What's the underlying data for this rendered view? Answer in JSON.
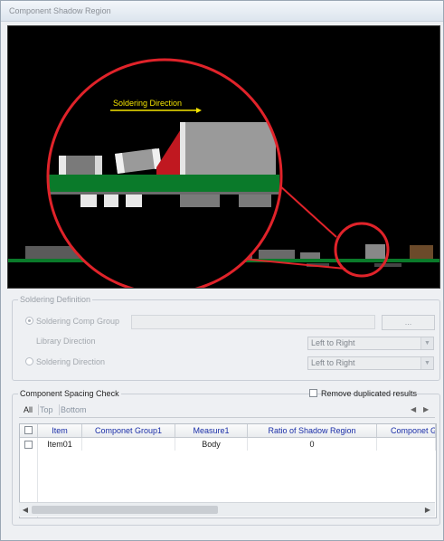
{
  "window": {
    "title": "Component Shadow Region"
  },
  "canvas": {
    "annotation": "Soldering Direction",
    "colors": {
      "pcb": "#0a7a2a",
      "magnifier": "#e0232a",
      "arrow": "#f5e400",
      "shadow": "#e0232a"
    }
  },
  "soldering_definition": {
    "title": "Soldering Definition",
    "comp_group_label": "Soldering Comp Group",
    "comp_group_value": "",
    "browse_label": "...",
    "library_direction_label": "Library Direction",
    "library_direction_value": "Left to Right",
    "soldering_direction_label": "Soldering Direction",
    "soldering_direction_value": "Left to Right",
    "comp_group_selected": true
  },
  "spacing_check": {
    "title": "Component Spacing Check",
    "remove_duplicates_label": "Remove duplicated results",
    "remove_duplicates_checked": false,
    "tabs": [
      "All",
      "Top",
      "Bottom"
    ],
    "active_tab": "All",
    "columns": [
      "Item",
      "Componet Group1",
      "Measure1",
      "Ratio of Shadow Region",
      "Componet Gr"
    ],
    "rows": [
      {
        "item": "Item01",
        "group1": "",
        "measure1": "Body",
        "ratio": "0",
        "group2": ""
      }
    ]
  },
  "icons": {
    "radio": "radio-button-icon",
    "dropdown": "chevron-down-icon",
    "prev": "triangle-left-icon",
    "next": "triangle-right-icon"
  }
}
